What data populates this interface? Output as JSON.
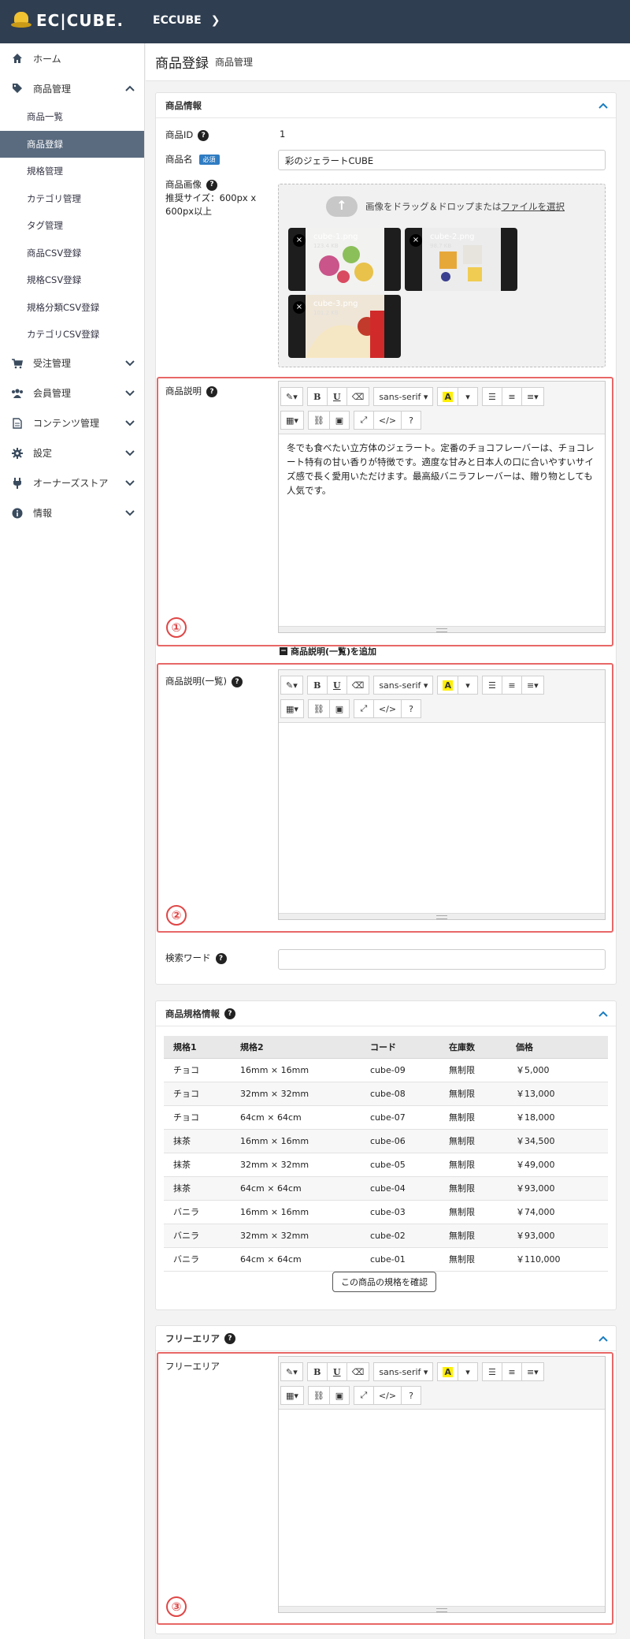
{
  "header": {
    "logo": "EC|CUBE.",
    "shop_name": "ECCUBE"
  },
  "sidebar": {
    "items": [
      {
        "label": "ホーム",
        "icon": "home-icon"
      },
      {
        "label": "商品管理",
        "icon": "tag-icon",
        "expanded": true
      },
      {
        "label": "受注管理",
        "icon": "cart-icon"
      },
      {
        "label": "会員管理",
        "icon": "users-icon"
      },
      {
        "label": "コンテンツ管理",
        "icon": "file-icon"
      },
      {
        "label": "設定",
        "icon": "gear-icon"
      },
      {
        "label": "オーナーズストア",
        "icon": "plug-icon"
      },
      {
        "label": "情報",
        "icon": "info-icon"
      }
    ],
    "sub_items": [
      "商品一覧",
      "商品登録",
      "規格管理",
      "カテゴリ管理",
      "タグ管理",
      "商品CSV登録",
      "規格CSV登録",
      "規格分類CSV登録",
      "カテゴリCSV登録"
    ],
    "active_sub": "商品登録"
  },
  "page": {
    "title": "商品登録",
    "subtitle": "商品管理"
  },
  "product_info": {
    "heading": "商品情報",
    "id_label": "商品ID",
    "id_value": "1",
    "name_label": "商品名",
    "required": "必須",
    "name_value": "彩のジェラートCUBE",
    "image_label": "商品画像",
    "image_hint": "推奨サイズ：600px x 600px以上",
    "dropzone_text": "画像をドラッグ＆ドロップまたは",
    "dropzone_link": "ファイルを選択",
    "images": [
      {
        "name": "cube-1.png",
        "size": "123.4 KB"
      },
      {
        "name": "cube-2.png",
        "size": "98.7 KB"
      },
      {
        "name": "cube-3.png",
        "size": "101.2 KB"
      }
    ],
    "desc_label": "商品説明",
    "desc_text": "冬でも食べたい立方体のジェラート。定番のチョコフレーバーは、チョコレート特有の甘い香りが特徴です。適度な甘みと日本人の口に合いやすいサイズ感で長く愛用いただけます。最高級バニラフレーバーは、贈り物としても人気です。",
    "add_list_desc": "商品説明(一覧)を追加",
    "list_desc_label": "商品説明(一覧)",
    "search_word_label": "検索ワード"
  },
  "editor_toolbar": {
    "font": "sans-serif",
    "help": "?",
    "codeview": "</>"
  },
  "spec": {
    "heading": "商品規格情報",
    "columns": [
      "規格1",
      "規格2",
      "コード",
      "在庫数",
      "価格"
    ],
    "rows": [
      [
        "チョコ",
        "16mm × 16mm",
        "cube-09",
        "無制限",
        "￥5,000"
      ],
      [
        "チョコ",
        "32mm × 32mm",
        "cube-08",
        "無制限",
        "￥13,000"
      ],
      [
        "チョコ",
        "64cm × 64cm",
        "cube-07",
        "無制限",
        "￥18,000"
      ],
      [
        "抹茶",
        "16mm × 16mm",
        "cube-06",
        "無制限",
        "￥34,500"
      ],
      [
        "抹茶",
        "32mm × 32mm",
        "cube-05",
        "無制限",
        "￥49,000"
      ],
      [
        "抹茶",
        "64cm × 64cm",
        "cube-04",
        "無制限",
        "￥93,000"
      ],
      [
        "バニラ",
        "16mm × 16mm",
        "cube-03",
        "無制限",
        "￥74,000"
      ],
      [
        "バニラ",
        "32mm × 32mm",
        "cube-02",
        "無制限",
        "￥93,000"
      ],
      [
        "バニラ",
        "64cm × 64cm",
        "cube-01",
        "無制限",
        "￥110,000"
      ]
    ],
    "confirm_button": "この商品の規格を確認"
  },
  "free_area": {
    "heading": "フリーエリア",
    "label": "フリーエリア"
  },
  "annotations": [
    "①",
    "②",
    "③"
  ],
  "colors": {
    "header": "#2f3e51",
    "accent": "#2f7cc2",
    "annotation": "#e86767"
  }
}
